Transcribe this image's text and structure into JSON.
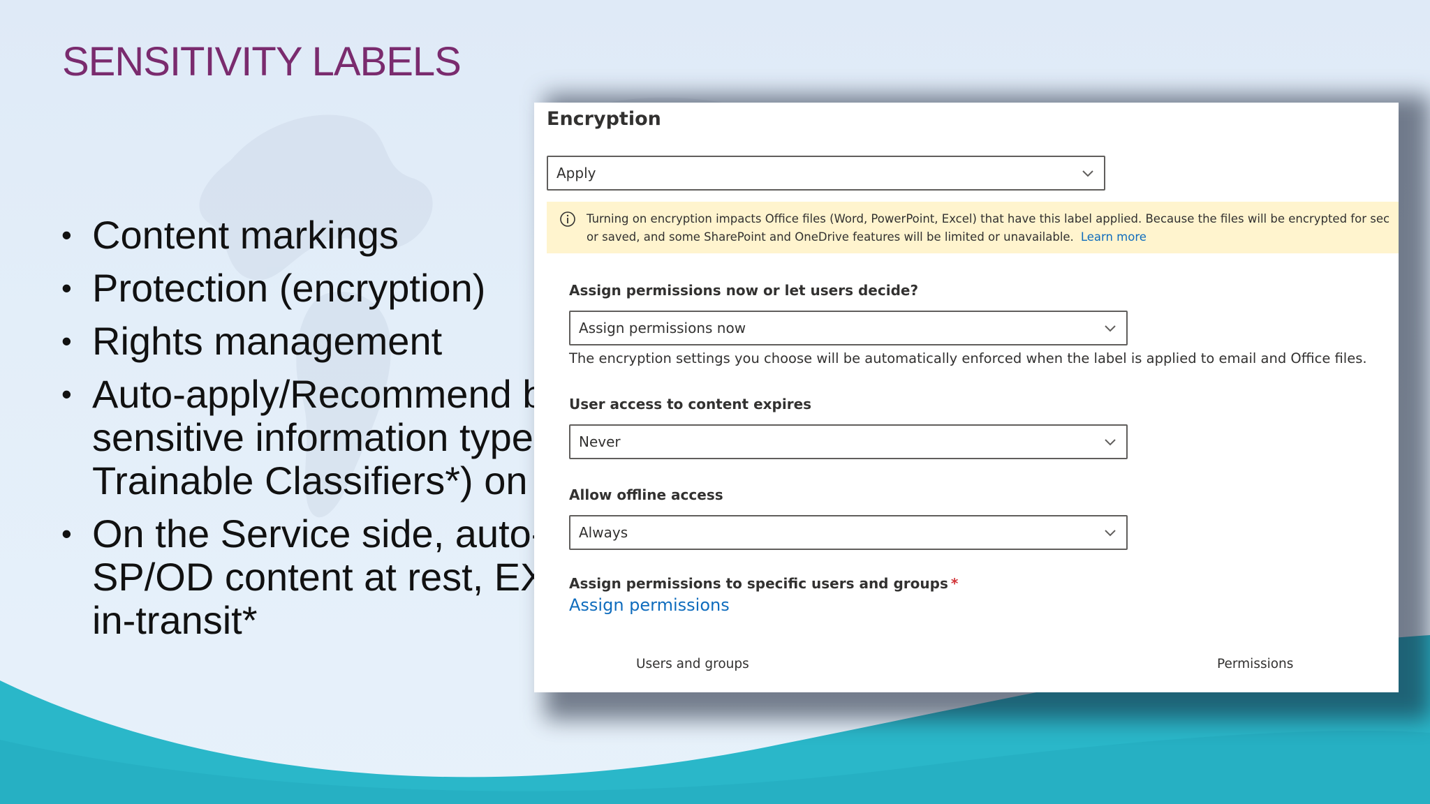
{
  "slide": {
    "title": "SENSITIVITY LABELS",
    "bullets": [
      {
        "lines": [
          "Content markings"
        ]
      },
      {
        "lines": [
          "Protection (encryption)"
        ]
      },
      {
        "lines": [
          "Rights management"
        ]
      },
      {
        "lines": [
          "Auto-apply/Recommend b",
          "sensitive information type",
          "Trainable Classifiers*) on th"
        ]
      },
      {
        "lines": [
          "On the Service side, auto-a",
          "SP/OD content at rest, EXC",
          "in-transit*"
        ]
      }
    ],
    "bullet_symbol": "•"
  },
  "panel": {
    "heading": "Encryption",
    "encryption_dropdown": {
      "value": "Apply"
    },
    "info_bar": {
      "icon": "info-icon",
      "line1": "Turning on encryption impacts Office files (Word, PowerPoint, Excel) that have this label applied. Because the files will be encrypted for sec",
      "line2": "or saved, and some SharePoint and OneDrive features will be limited or unavailable.",
      "link": "Learn more"
    },
    "assign_mode": {
      "label": "Assign permissions now or let users decide?",
      "value": "Assign permissions now",
      "helper": "The encryption settings you choose will be automatically enforced when the label is applied to email and Office files."
    },
    "expires": {
      "label": "User access to content expires",
      "value": "Never"
    },
    "offline": {
      "label": "Allow offline access",
      "value": "Always"
    },
    "assign_specific": {
      "label": "Assign permissions to specific users and groups",
      "required_marker": "*",
      "link": "Assign permissions"
    },
    "table": {
      "columns": [
        "Users and groups",
        "Permissions"
      ]
    }
  },
  "colors": {
    "title": "#7a2b6e",
    "link": "#0f6cbd",
    "info_bar_bg": "#fff4ce",
    "wave": "#2ab7c9",
    "required": "#d13438"
  }
}
